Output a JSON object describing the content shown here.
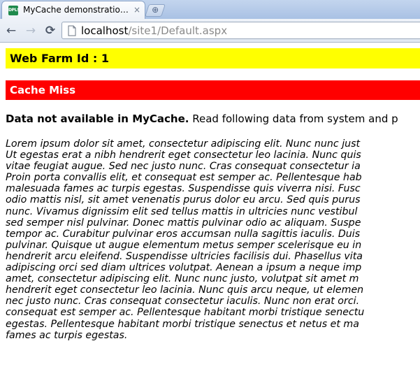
{
  "browser": {
    "tab_title": "MyCache demonstration ...",
    "favicon_text": "DPLS",
    "close_glyph": "×",
    "new_tab_glyph": "⊕",
    "back_glyph": "←",
    "forward_glyph": "→",
    "reload_glyph": "⟳",
    "url_host": "localhost",
    "url_path": "/site1/Default.aspx"
  },
  "page": {
    "webfarm_label": "Web Farm Id : 1",
    "cache_status": "Cache Miss",
    "cache_status_color": "#ff0000",
    "webfarm_color": "#ffff00",
    "notice_bold": "Data not available in MyCache.",
    "notice_rest": " Read following data from system and p",
    "lorem_lines": [
      "Lorem ipsum dolor sit amet, consectetur adipiscing elit. Nunc nunc just",
      "Ut egestas erat a nibh hendrerit eget consectetur leo lacinia. Nunc quis",
      "vitae feugiat augue. Sed nec justo nunc. Cras consequat consectetur ia",
      "Proin porta convallis elit, et consequat est semper ac. Pellentesque hab",
      "malesuada fames ac turpis egestas. Suspendisse quis viverra nisi. Fusc",
      "odio mattis nisl, sit amet venenatis purus dolor eu arcu. Sed quis purus",
      "nunc. Vivamus dignissim elit sed tellus mattis in ultricies nunc vestibul",
      "sed semper nisl pulvinar. Donec mattis pulvinar odio ac aliquam. Suspe",
      "tempor ac. Curabitur pulvinar eros accumsan nulla sagittis iaculis. Duis",
      "pulvinar. Quisque ut augue elementum metus semper scelerisque eu in",
      "hendrerit arcu eleifend. Suspendisse ultricies facilisis dui. Phasellus vita",
      "adipiscing orci sed diam ultrices volutpat. Aenean a ipsum a neque imp",
      "amet, consectetur adipiscing elit. Nunc nunc justo, volutpat sit amet m",
      "hendrerit eget consectetur leo lacinia. Nunc quis arcu neque, ut elemen",
      "nec justo nunc. Cras consequat consectetur iaculis. Nunc non erat orci.",
      "consequat est semper ac. Pellentesque habitant morbi tristique senectu",
      "egestas. Pellentesque habitant morbi tristique senectus et netus et ma",
      "fames ac turpis egestas."
    ]
  }
}
